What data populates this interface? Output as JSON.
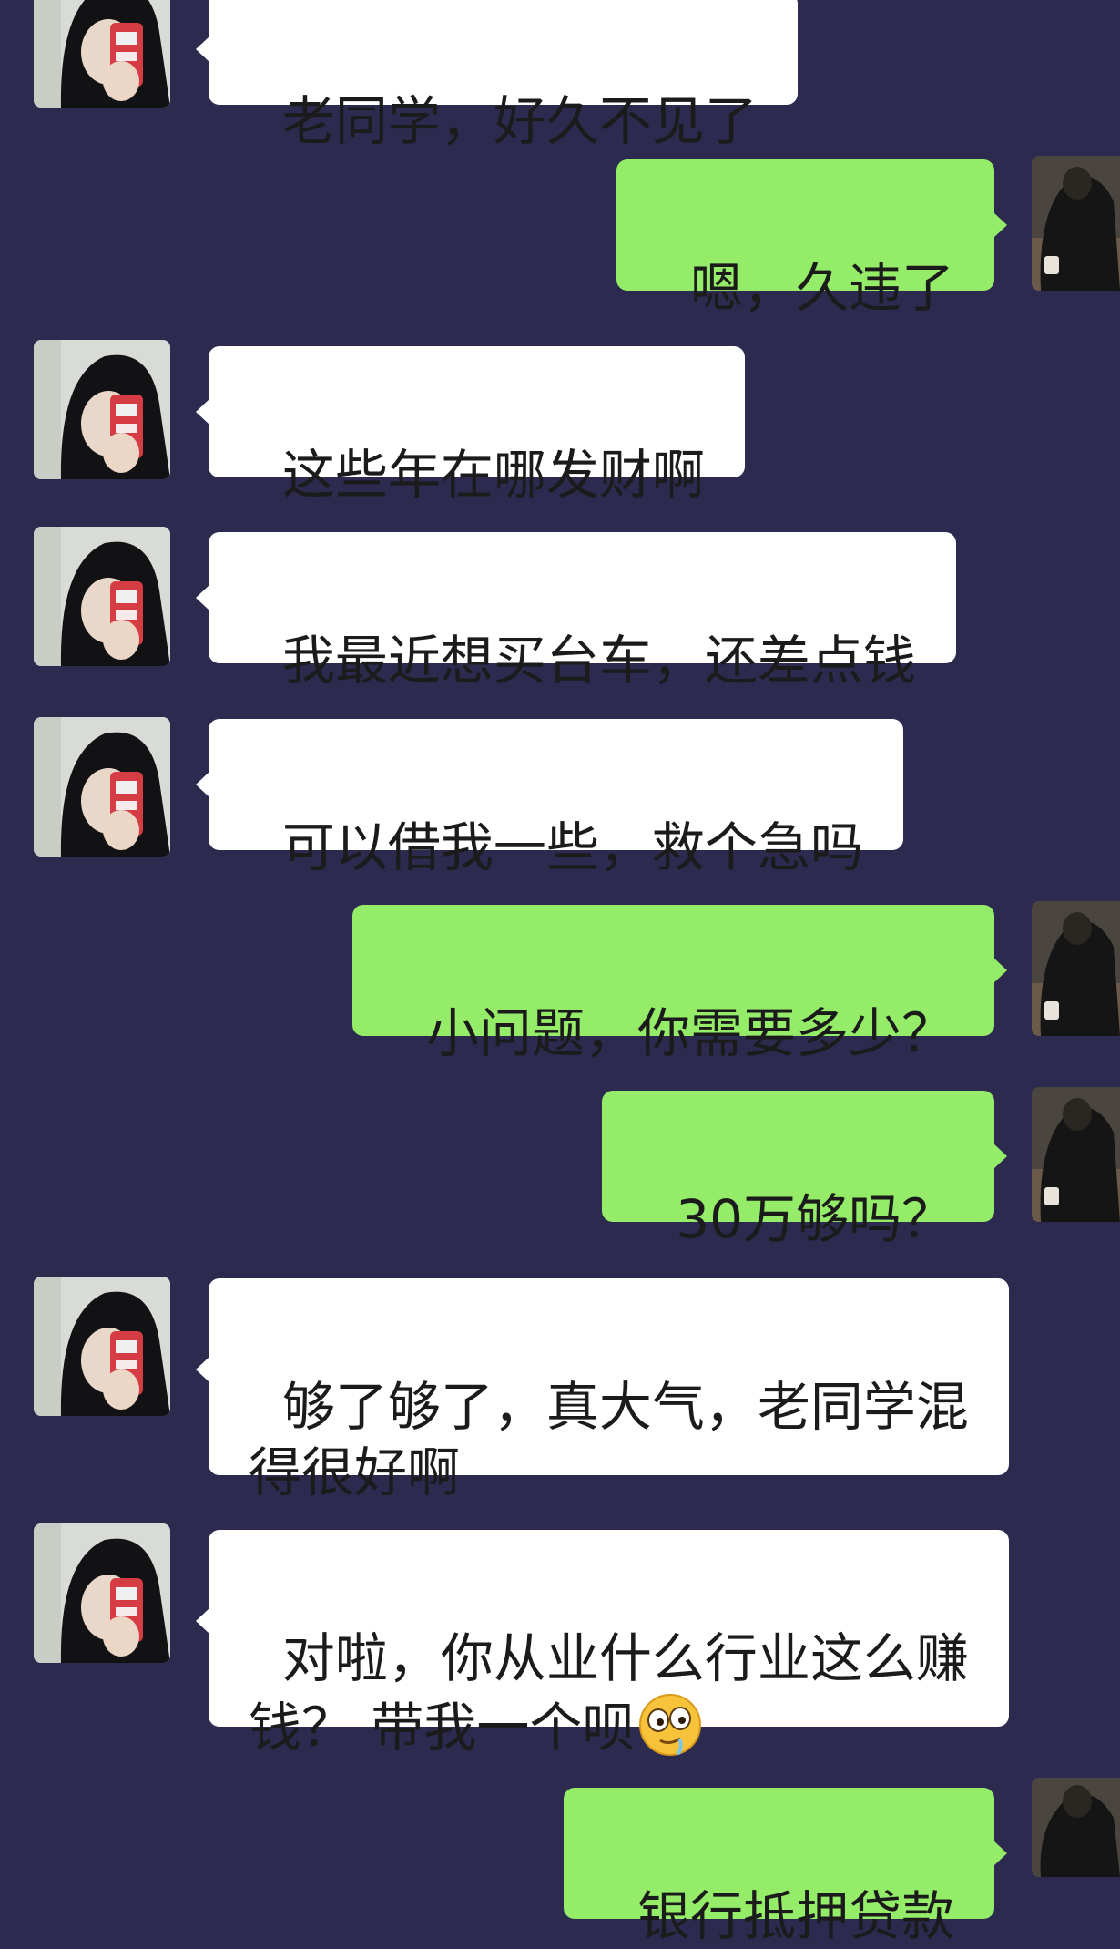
{
  "chat": {
    "messages": [
      {
        "side": "in",
        "text": "老同学，好久不见了"
      },
      {
        "side": "out",
        "text": "嗯，久违了"
      },
      {
        "side": "in",
        "text": "这些年在哪发财啊"
      },
      {
        "side": "in",
        "text": "我最近想买台车，还差点钱"
      },
      {
        "side": "in",
        "text": "可以借我一些，救个急吗"
      },
      {
        "side": "out",
        "text": "小问题，你需要多少？"
      },
      {
        "side": "out",
        "text": "30万够吗？"
      },
      {
        "side": "in",
        "text": "够了够了，真大气，老同学混得很好啊"
      },
      {
        "side": "in",
        "text": "对啦，你从业什么行业这么赚钱？ 带我一个呗",
        "emoji": "drooling-face-icon"
      },
      {
        "side": "out",
        "text": "银行抵押贷款"
      }
    ]
  },
  "colors": {
    "background": "#2c2a4f",
    "incoming_bubble": "#ffffff",
    "outgoing_bubble": "#95ec69"
  }
}
